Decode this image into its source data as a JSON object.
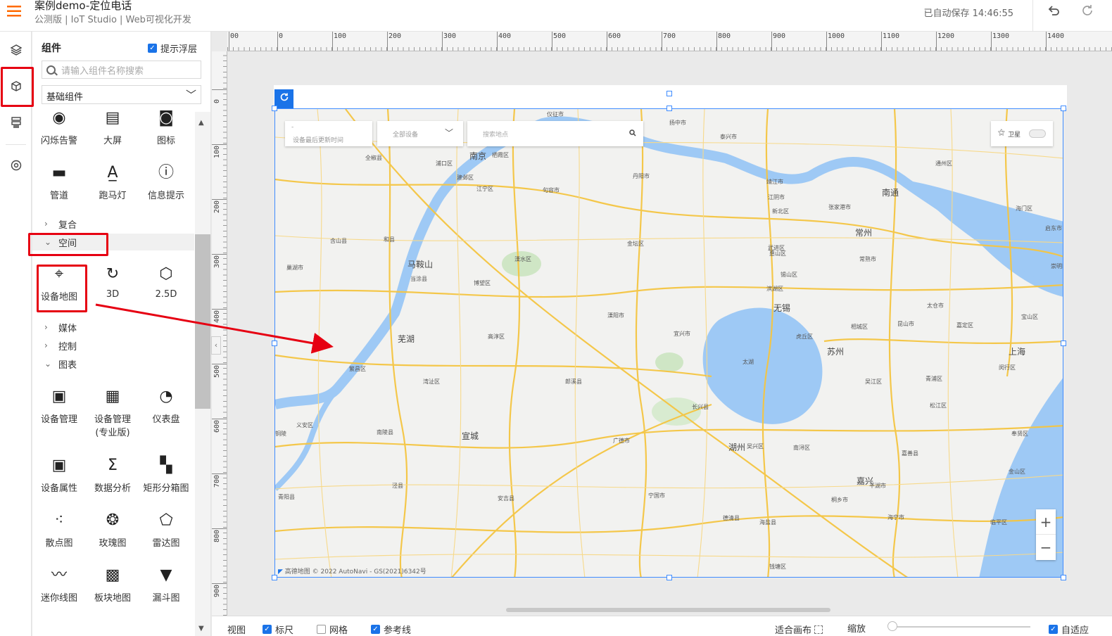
{
  "app": {
    "title": "案例demo-定位电话",
    "subtitle": "公测版 | IoT Studio | Web可视化开发",
    "autosave": "已自动保存 14:46:55"
  },
  "panel": {
    "title": "组件",
    "overlay_label": "提示浮层",
    "overlay_checked": true,
    "search_placeholder": "请输入组件名称搜索",
    "category_select": "基础组件",
    "top_components": [
      {
        "label": "闪烁告警",
        "icon": "flash-alarm-icon"
      },
      {
        "label": "大屏",
        "icon": "big-screen-icon"
      },
      {
        "label": "图标",
        "icon": "icon-icon"
      },
      {
        "label": "管道",
        "icon": "pipe-icon"
      },
      {
        "label": "跑马灯",
        "icon": "marquee-icon"
      },
      {
        "label": "信息提示",
        "icon": "info-tip-icon"
      }
    ],
    "categories": {
      "composite": "复合",
      "space": "空间",
      "media": "媒体",
      "control": "控制",
      "chart": "图表"
    },
    "space_components": [
      {
        "label": "设备地图",
        "icon": "device-map-icon"
      },
      {
        "label": "3D",
        "icon": "3d-icon"
      },
      {
        "label": "2.5D",
        "icon": "cube-icon"
      }
    ],
    "chart_components": [
      {
        "label": "设备管理",
        "icon": "device-manage-icon"
      },
      {
        "label": "设备管理\n(专业版)",
        "icon": "device-manage-pro-icon"
      },
      {
        "label": "仪表盘",
        "icon": "gauge-icon"
      },
      {
        "label": "设备属性",
        "icon": "device-property-icon"
      },
      {
        "label": "数据分析",
        "icon": "data-analysis-icon"
      },
      {
        "label": "矩形分箱图",
        "icon": "rect-bin-icon"
      },
      {
        "label": "散点图",
        "icon": "scatter-icon"
      },
      {
        "label": "玫瑰图",
        "icon": "rose-icon"
      },
      {
        "label": "雷达图",
        "icon": "radar-icon"
      },
      {
        "label": "迷你线图",
        "icon": "sparkline-icon"
      },
      {
        "label": "板块地图",
        "icon": "block-map-icon"
      },
      {
        "label": "漏斗图",
        "icon": "funnel-icon"
      }
    ]
  },
  "ruler": {
    "h": [
      "00",
      "0",
      "100",
      "200",
      "300",
      "400",
      "500",
      "600",
      "700",
      "800",
      "900",
      "1000",
      "1100",
      "1200",
      "1300",
      "1400"
    ],
    "v": [
      "0",
      "100",
      "200",
      "300",
      "400",
      "500",
      "600",
      "700",
      "800",
      "900"
    ]
  },
  "map": {
    "time_label": "设备最后更新时间",
    "time_dash": "-",
    "device_select": "全部设备",
    "search_placeholder": "搜索地点",
    "satellite_label": "卫星",
    "attribution": "高德地图 © 2022 AutoNavi - GS(2021)6342号",
    "cities": [
      "仪征市",
      "扬中市",
      "泰兴市",
      "南京",
      "栖霞区",
      "全椒县",
      "浦口区",
      "建邺区",
      "丹阳市",
      "江宁区",
      "句容市",
      "靖江市",
      "通州区",
      "南通",
      "江阴市",
      "张家港市",
      "海门区",
      "新北区",
      "常州",
      "启东市",
      "含山县",
      "和县",
      "金坛区",
      "武进区",
      "惠山区",
      "巢湖市",
      "马鞍山",
      "溧水区",
      "常熟市",
      "当涂县",
      "锡山区",
      "崇明区",
      "博望区",
      "滨湖区",
      "无锡",
      "太仓市",
      "溧阳市",
      "宜兴市",
      "相城区",
      "虎丘区",
      "昆山市",
      "嘉定区",
      "宝山区",
      "芜湖",
      "高淳区",
      "苏州",
      "上海",
      "太湖",
      "繁昌区",
      "湾沚区",
      "郎溪县",
      "青浦区",
      "吴江区",
      "闵行区",
      "长兴县",
      "松江区",
      "义安区",
      "南陵县",
      "宣城",
      "广德市",
      "湖州",
      "吴兴区",
      "南浔区",
      "嘉善县",
      "奉贤区",
      "铜陵",
      "金山区",
      "泾县",
      "青阳县",
      "安吉县",
      "嘉兴",
      "平湖市",
      "宁国市",
      "德清县",
      "桐乡市",
      "海宁市",
      "海盐县",
      "临平区",
      "钱塘区"
    ]
  },
  "bottombar": {
    "view": "视图",
    "ruler": "标尺",
    "ruler_checked": true,
    "grid": "网格",
    "grid_checked": false,
    "guide": "参考线",
    "guide_checked": true,
    "fit_canvas": "适合画布",
    "zoom": "缩放",
    "adaptive": "自适应",
    "adaptive_checked": true
  },
  "colors": {
    "accent": "#1a73e8",
    "annotation_red": "#e60012",
    "menu_orange": "#ff6a00",
    "selection_blue": "#3f8cff",
    "water": "#9ec9f5",
    "road": "#f5c542"
  }
}
